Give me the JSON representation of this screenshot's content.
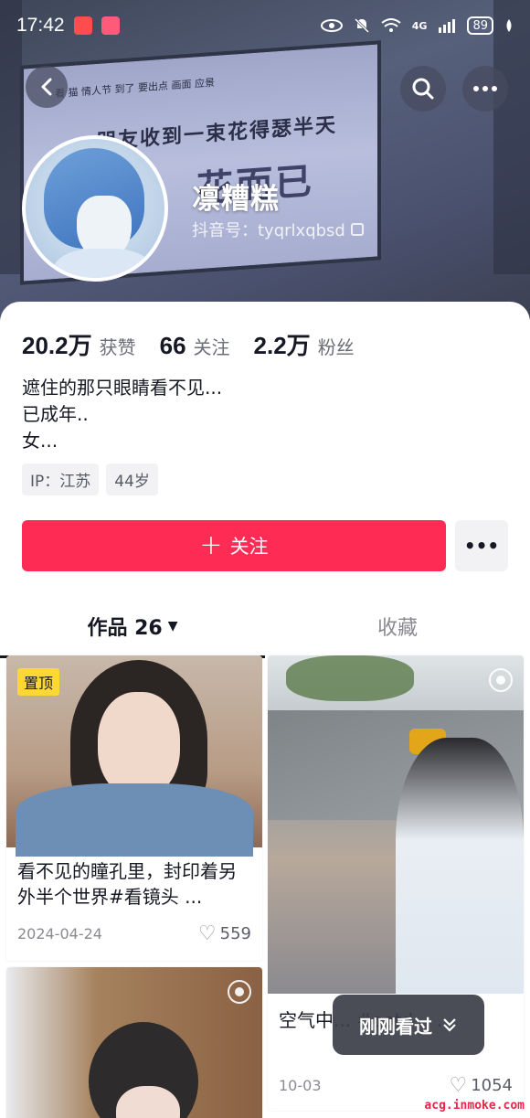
{
  "status_bar": {
    "time": "17:42",
    "battery": "89",
    "network": "4G"
  },
  "banner": {
    "billboard_small": "看 猫 情人节 到了 要出点 画面 应景",
    "billboard_mid": "朋友收到一束花得瑟半天",
    "billboard_big": "花而已"
  },
  "profile": {
    "nickname": "凛糟糕",
    "douyin_id": "抖音号：tyqrlxqbsd"
  },
  "stats": [
    {
      "value": "20.2万",
      "label": "获赞"
    },
    {
      "value": "66",
      "label": "关注"
    },
    {
      "value": "2.2万",
      "label": "粉丝"
    }
  ],
  "bio": {
    "line1": "遮住的那只眼睛看不见...",
    "line2": "已成年..",
    "line3": "女..."
  },
  "tags": {
    "ip": "IP：江苏",
    "age": "44岁"
  },
  "actions": {
    "follow_label": "关注",
    "follow_plus": "+",
    "more": "•••"
  },
  "tabs": {
    "works": "作品 26",
    "favorites": "收藏"
  },
  "videos": [
    {
      "pinned": "置顶",
      "caption": "看不见的瞳孔里，封印着另外半个世界#看镜头 ...",
      "date": "2024-04-24",
      "likes": "559"
    },
    {
      "caption": "空气中... #ootd... ...",
      "date": "10-03",
      "likes": "1054"
    }
  ],
  "recent_pill": "刚刚看过",
  "watermark": "acg.inmoke.com",
  "colors": {
    "follow": "#fe2c55",
    "pin_badge": "#fdd835",
    "text_primary": "#161823",
    "text_secondary": "#8a8b91"
  }
}
